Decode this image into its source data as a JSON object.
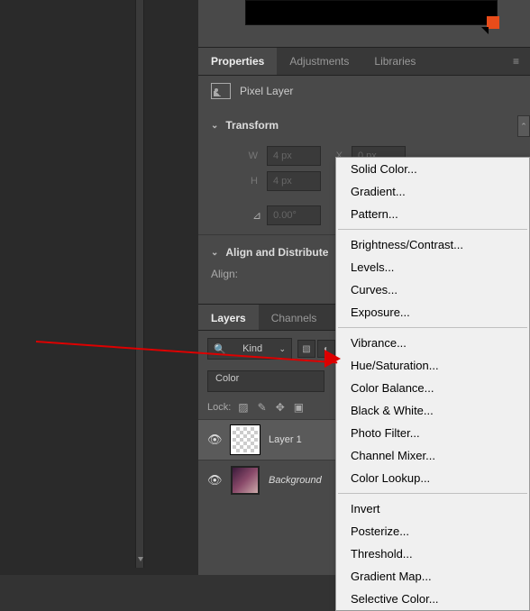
{
  "tabs": {
    "properties": "Properties",
    "adjustments": "Adjustments",
    "libraries": "Libraries"
  },
  "pixel_layer": {
    "label": "Pixel Layer"
  },
  "transform": {
    "title": "Transform",
    "w_label": "W",
    "w_value": "4 px",
    "x_label": "X",
    "x_value": "0 px",
    "h_label": "H",
    "h_value": "4 px",
    "angle_value": "0.00°"
  },
  "align": {
    "title": "Align and Distribute",
    "label": "Align:"
  },
  "layers_tabs": {
    "layers": "Layers",
    "channels": "Channels"
  },
  "layers_panel": {
    "kind_label": "Kind",
    "search_icon": "🔍",
    "blend_mode": "Color",
    "lock_label": "Lock:"
  },
  "layers": [
    {
      "name": "Layer 1",
      "italic": false
    },
    {
      "name": "Background",
      "italic": true
    }
  ],
  "context_menu": {
    "groups": [
      [
        "Solid Color...",
        "Gradient...",
        "Pattern..."
      ],
      [
        "Brightness/Contrast...",
        "Levels...",
        "Curves...",
        "Exposure..."
      ],
      [
        "Vibrance...",
        "Hue/Saturation...",
        "Color Balance...",
        "Black & White...",
        "Photo Filter...",
        "Channel Mixer...",
        "Color Lookup..."
      ],
      [
        "Invert",
        "Posterize...",
        "Threshold...",
        "Gradient Map...",
        "Selective Color..."
      ]
    ]
  }
}
